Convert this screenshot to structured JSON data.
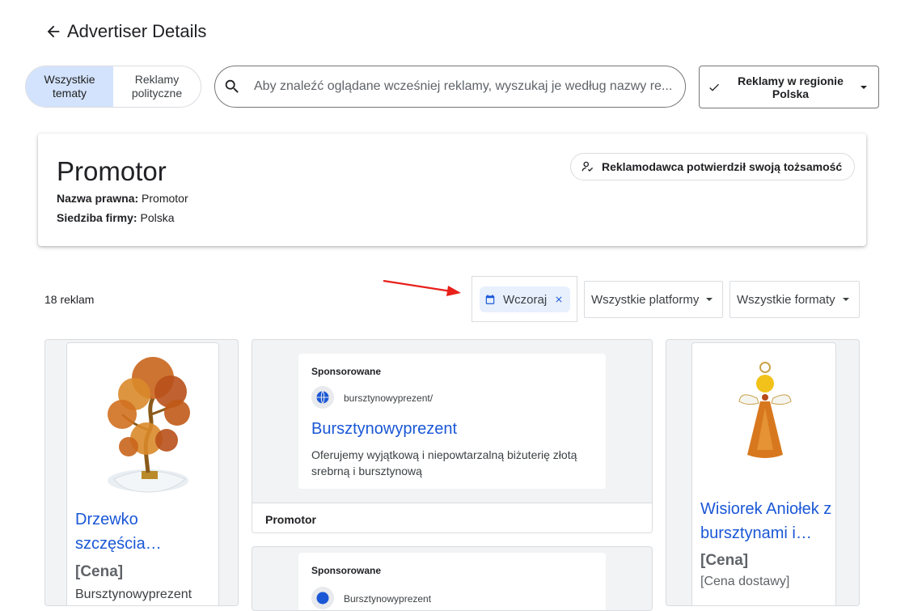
{
  "header": {
    "title": "Advertiser Details"
  },
  "topic_toggle": {
    "options": [
      {
        "label": "Wszystkie tematy"
      },
      {
        "label": "Reklamy polityczne"
      }
    ]
  },
  "search": {
    "placeholder": "Aby znaleźć oglądane wcześniej reklamy, wyszukaj je według nazwy re..."
  },
  "region": {
    "label": "Reklamy w regionie Polska"
  },
  "advertiser": {
    "name": "Promotor",
    "legal_name_label": "Nazwa prawna:",
    "legal_name_value": "Promotor",
    "hq_label": "Siedziba firmy:",
    "hq_value": "Polska",
    "verified_label": "Reklamodawca potwierdził swoją tożsamość"
  },
  "filters": {
    "count_label": "18 reklam",
    "date_chip": "Wczoraj",
    "platforms": "Wszystkie platformy",
    "formats": "Wszystkie formaty"
  },
  "ads": {
    "product1": {
      "title": "Drzewko szczęścia…",
      "price": "[Cena]",
      "merchant": "Bursztynowyprezent"
    },
    "text_ad1": {
      "sponsored": "Sponsorowane",
      "domain": "bursztynowyprezent/",
      "headline": "Bursztynowyprezent",
      "description": "Oferujemy wyjątkową i niepowtarzalną biżuterię złotą srebrną i bursztynową",
      "advertiser": "Promotor"
    },
    "text_ad2": {
      "sponsored": "Sponsorowane",
      "domain": "Bursztynowyprezent"
    },
    "product2": {
      "title": "Wisiorek Aniołek z bursztynami i…",
      "price": "[Cena]",
      "shipping": "[Cena dostawy]"
    }
  },
  "colors": {
    "accent_blue": "#1a57d6",
    "toggle_active": "#d3e3fd",
    "chip_bg": "#e8f0fe",
    "annotation_red": "#e8201a"
  }
}
